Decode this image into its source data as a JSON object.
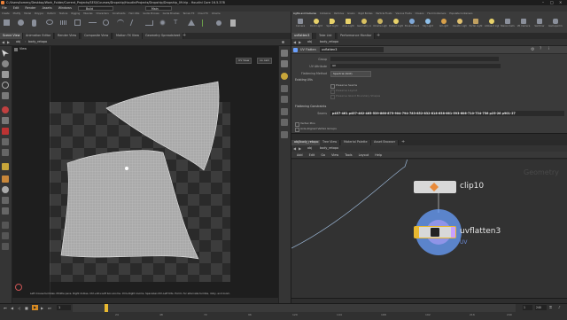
{
  "window": {
    "title": "C:/Users/tommy/Desktop/Work_Folder/Current_Projects/SESI/Courses/Dropship/HoudiniProjects/Dropship/Dropship_09.hip - Houdini Core 16.5.378"
  },
  "menubar": {
    "items": [
      "File",
      "Edit",
      "Render",
      "Assets",
      "Windows",
      "Help"
    ],
    "desktop": "Build",
    "main": "Main"
  },
  "shelf": {
    "left_tabs": [
      "Create",
      "Modify",
      "Model",
      "Polygon",
      "Deform",
      "Texture",
      "Rigging",
      "Muscles",
      "Characters",
      "Constraints",
      "Hair Utils",
      "Guide Process",
      "Guide Brushes",
      "Terrain FX",
      "Cloud FX",
      "Volume"
    ],
    "right_tabs": [
      "Lights and Cameras",
      "Collisions",
      "Particles",
      "Grains",
      "Rigid Bodies",
      "Particle Fluids",
      "Viscous Fluids",
      "Oceans",
      "Fluid Containers",
      "Populate Containers"
    ],
    "tools": [
      "Camera",
      "Point Light",
      "Spot Light",
      "Area Light",
      "Geometry Light",
      "Volume Light",
      "Distant Light",
      "Environment Light",
      "Sky Light",
      "GI Light",
      "Caustic Light",
      "Portal Light",
      "Ambient Light",
      "Stereo Camera",
      "VR Camera",
      "Switcher",
      "Gamepad Camera"
    ]
  },
  "left_pane": {
    "tabs": [
      "Scene View",
      "Animation Editor",
      "Render View",
      "Composite View",
      "Motion FX View",
      "Geometry Spreadsheet"
    ],
    "path": [
      "obj",
      "body_retopo"
    ],
    "viewport_label": "View",
    "uv_view_label": "UV View",
    "camera_label": "no cam",
    "status_text": "Left mouse tumbles. Middle pans. Right dollies. Ctrl+Alt+Left box-zooms. Ctrl+Right zooms. Spacebar-Ctrl-Left tilts. Hold L for alternate tumble, dolly, and zoom."
  },
  "param_pane": {
    "tabs": [
      "uvflatten3",
      "Take List",
      "Performance Monitor"
    ],
    "path": [
      "obj",
      "body_retopo"
    ],
    "node_type": "UV Flatten",
    "node_name": "uvflatten3",
    "params": [
      {
        "label": "Group",
        "value": ""
      },
      {
        "label": "UV Attribute",
        "value": "uv"
      },
      {
        "label": "Flattening Method",
        "value": "Spectral (SCP)"
      }
    ],
    "section_existing": "Existing UVs",
    "checks": [
      "Preserve Seams",
      "Preserve Layout",
      "Preserve Island Boundary Shapes"
    ],
    "section_constraints": "Flattening Constraints",
    "seams_label": "Seams",
    "seams_value": "p457-461 p457-462-465-539-866-875-904-794-783-852-832-818-658-661-593-606-710-734-756 p25-26 p901-27",
    "footer_checks": [
      "Vertex Pins",
      "Axis-Aligned Vertex Groups"
    ]
  },
  "network_pane": {
    "tabs": [
      "obj/body_retopo",
      "Tree View",
      "Material Palette",
      "Asset Browser"
    ],
    "path": [
      "obj",
      "body_retopo"
    ],
    "menu": [
      "Add",
      "Edit",
      "Go",
      "View",
      "Tools",
      "Layout",
      "Help"
    ],
    "context_label": "Geometry",
    "nodes": [
      {
        "name": "clip10",
        "sublabel": ""
      },
      {
        "name": "uvflatten3",
        "sublabel": "UV"
      }
    ]
  },
  "timeline": {
    "frame": "1",
    "start": "1",
    "end": "240",
    "marks": [
      "24",
      "48",
      "72",
      "96",
      "120",
      "144",
      "168",
      "192",
      "216",
      "240"
    ]
  },
  "colors": {
    "accent_yellow": "#e8b830",
    "node_blue": "#6aa0ff",
    "uv_text": "#6a8ad8",
    "timeline_orange": "#d88a22"
  }
}
